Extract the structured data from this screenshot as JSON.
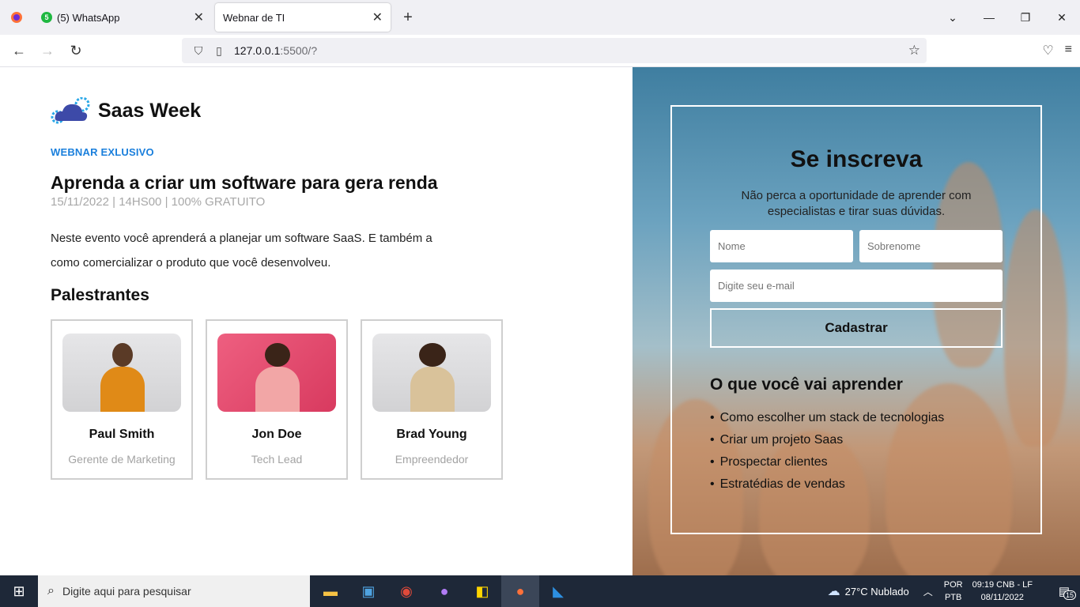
{
  "browser": {
    "tabs": [
      {
        "label": "(5) WhatsApp",
        "badge": "5"
      },
      {
        "label": "Webnar de TI"
      }
    ],
    "url_host": "127.0.0.1",
    "url_rest": ":5500/?"
  },
  "header": {
    "logo_title": "Saas Week",
    "kicker": "WEBNAR EXLUSIVO",
    "headline": "Aprenda a criar um software para gera renda",
    "meta": "15/11/2022 | 14HS00 | 100% GRATUITO",
    "description": "Neste evento você aprenderá a planejar um software SaaS. E também a como comercializar o produto que você desenvolveu."
  },
  "speakers": {
    "title": "Palestrantes",
    "items": [
      {
        "name": "Paul Smith",
        "role": "Gerente de Marketing"
      },
      {
        "name": "Jon Doe",
        "role": "Tech Lead"
      },
      {
        "name": "Brad Young",
        "role": "Empreendedor"
      }
    ]
  },
  "form": {
    "title": "Se inscreva",
    "subtitle": "Não perca a oportunidade de aprender com especialistas e tirar suas dúvidas.",
    "first_name_placeholder": "Nome",
    "last_name_placeholder": "Sobrenome",
    "email_placeholder": "Digite seu e-mail",
    "submit_label": "Cadastrar"
  },
  "learn": {
    "title": "O que você vai aprender",
    "items": [
      "Como escolher um stack de tecnologias",
      "Criar um projeto Saas",
      "Prospectar clientes",
      "Estratédias de vendas"
    ]
  },
  "taskbar": {
    "search_placeholder": "Digite aqui para pesquisar",
    "weather": "27°C  Nublado",
    "lang_top": "POR",
    "lang_bottom": "PTB",
    "time": "09:19 CNB - LF",
    "date": "08/11/2022",
    "notifications": "15"
  },
  "colors": {
    "accent": "#1a7fdc",
    "muted": "#a8a8a8"
  }
}
